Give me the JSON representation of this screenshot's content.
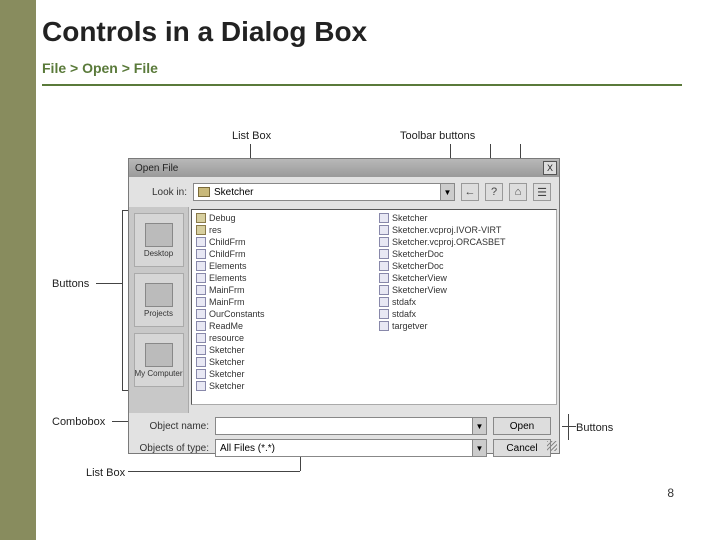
{
  "slide": {
    "title": "Controls in a Dialog Box",
    "breadcrumb": "File > Open > File",
    "page_number": "8"
  },
  "callouts": {
    "listbox_top": "List Box",
    "toolbar_buttons": "Toolbar buttons",
    "buttons_left": "Buttons",
    "combobox": "Combobox",
    "listbox_bottom": "List Box",
    "buttons_right": "Buttons"
  },
  "dialog": {
    "title": "Open File",
    "close_glyph": "X",
    "lookin_label": "Look in:",
    "lookin_value": "Sketcher",
    "dd_glyph": "▼",
    "toolbar_icons": [
      "←",
      "?",
      "⌂",
      "☰"
    ],
    "places": [
      {
        "label": "Desktop"
      },
      {
        "label": "Projects"
      },
      {
        "label": "My Computer"
      }
    ],
    "files_col1": [
      {
        "name": "Debug",
        "kind": "folder"
      },
      {
        "name": "res",
        "kind": "folder"
      },
      {
        "name": "ChildFrm",
        "kind": "doc"
      },
      {
        "name": "ChildFrm",
        "kind": "doc"
      },
      {
        "name": "Elements",
        "kind": "doc"
      },
      {
        "name": "Elements",
        "kind": "doc"
      },
      {
        "name": "MainFrm",
        "kind": "doc"
      },
      {
        "name": "MainFrm",
        "kind": "doc"
      },
      {
        "name": "OurConstants",
        "kind": "doc"
      },
      {
        "name": "ReadMe",
        "kind": "doc"
      },
      {
        "name": "resource",
        "kind": "doc"
      },
      {
        "name": "Sketcher",
        "kind": "doc"
      },
      {
        "name": "Sketcher",
        "kind": "doc"
      },
      {
        "name": "Sketcher",
        "kind": "doc"
      }
    ],
    "files_col2": [
      {
        "name": "Sketcher",
        "kind": "doc"
      },
      {
        "name": "Sketcher",
        "kind": "doc"
      },
      {
        "name": "Sketcher.vcproj.IVOR-VIRT",
        "kind": "doc"
      },
      {
        "name": "Sketcher.vcproj.ORCASBET",
        "kind": "doc"
      },
      {
        "name": "SketcherDoc",
        "kind": "doc"
      },
      {
        "name": "SketcherDoc",
        "kind": "doc"
      },
      {
        "name": "SketcherView",
        "kind": "doc"
      },
      {
        "name": "SketcherView",
        "kind": "doc"
      },
      {
        "name": "stdafx",
        "kind": "doc"
      },
      {
        "name": "stdafx",
        "kind": "doc"
      },
      {
        "name": "targetver",
        "kind": "doc"
      }
    ],
    "objname_label": "Object name:",
    "objname_value": "",
    "objtype_label": "Objects of type:",
    "objtype_value": "All Files (*.*)",
    "open_btn": "Open",
    "cancel_btn": "Cancel"
  }
}
